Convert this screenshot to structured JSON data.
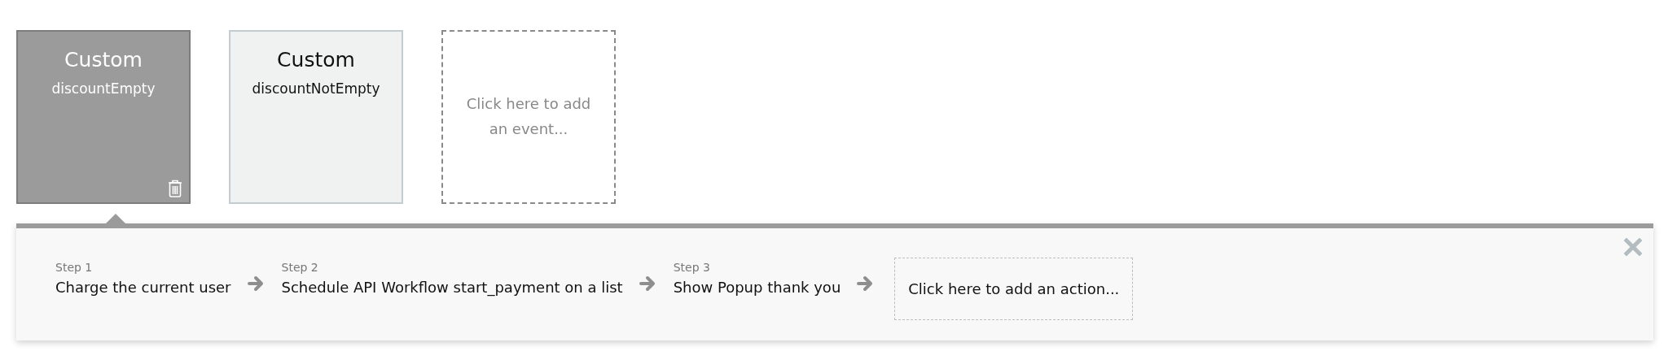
{
  "events": [
    {
      "kind": "event",
      "title": "Custom",
      "subtitle": "discountEmpty",
      "selected": true
    },
    {
      "kind": "event",
      "title": "Custom",
      "subtitle": "discountNotEmpty",
      "selected": false
    },
    {
      "kind": "add",
      "label": "Click here to add an event..."
    }
  ],
  "workflow": {
    "steps": [
      {
        "kind": "step",
        "step": "Step 1",
        "action": "Charge the current user"
      },
      {
        "kind": "step",
        "step": "Step 2",
        "action": "Schedule API Workflow start_payment on a list"
      },
      {
        "kind": "step",
        "step": "Step 3",
        "action": "Show Popup thank you"
      },
      {
        "kind": "add",
        "label": "Click here to add an action..."
      }
    ]
  }
}
